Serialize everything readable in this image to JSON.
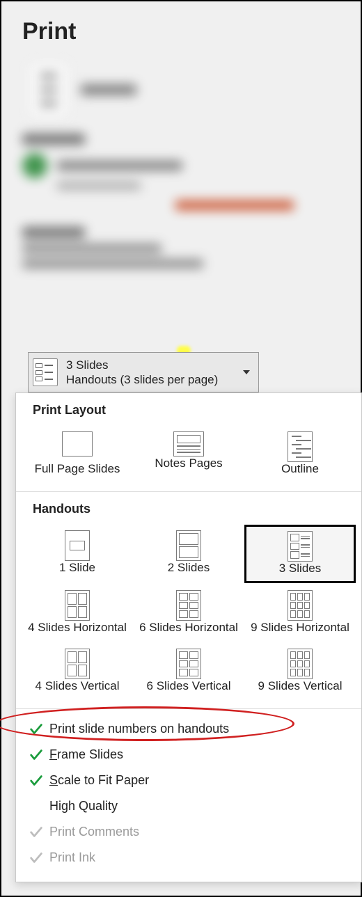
{
  "title": "Print",
  "dropdown": {
    "line1": "3 Slides",
    "line2": "Handouts (3 slides per page)"
  },
  "sections": {
    "print_layout_title": "Print Layout",
    "handouts_title": "Handouts"
  },
  "print_layout": {
    "full_page": "Full Page Slides",
    "notes_pages": "Notes Pages",
    "outline": "Outline"
  },
  "handouts": {
    "one_slide": "1 Slide",
    "two_slides": "2 Slides",
    "three_slides": "3 Slides",
    "four_h": "4 Slides Horizontal",
    "six_h": "6 Slides Horizontal",
    "nine_h": "9 Slides Horizontal",
    "four_v": "4 Slides Vertical",
    "six_v": "6 Slides Vertical",
    "nine_v": "9 Slides Vertical"
  },
  "options": {
    "print_slide_numbers": "Print slide numbers on handouts",
    "frame_prefix": "F",
    "frame_rest": "rame Slides",
    "scale_prefix": "S",
    "scale_rest": "cale to Fit Paper",
    "high_quality": "High Quality",
    "print_comments": "Print Comments",
    "print_ink": "Print Ink"
  },
  "option_states": {
    "print_slide_numbers": true,
    "frame_slides": true,
    "scale_to_fit": true,
    "high_quality": false,
    "print_comments": false,
    "print_ink": false
  }
}
